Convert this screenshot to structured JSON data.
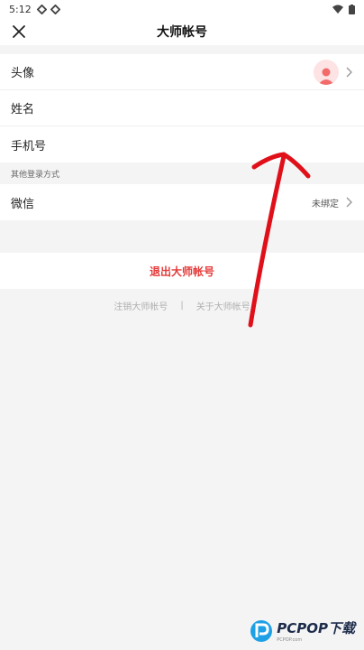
{
  "status_bar": {
    "time": "5:12"
  },
  "navbar": {
    "title": "大师帐号"
  },
  "profile": {
    "avatar_label": "头像",
    "name_label": "姓名",
    "phone_label": "手机号"
  },
  "other_login": {
    "section_label": "其他登录方式",
    "wechat_label": "微信",
    "wechat_status": "未绑定"
  },
  "actions": {
    "logout_label": "退出大师帐号",
    "cancel_account_label": "注销大师帐号",
    "separator": "|",
    "about_label": "关于大师帐号"
  },
  "watermark": {
    "brand": "PCPOP下载",
    "sub": "PCPOP.com"
  },
  "colors": {
    "accent": "#e53a3a",
    "annotation": "#e0101a"
  }
}
